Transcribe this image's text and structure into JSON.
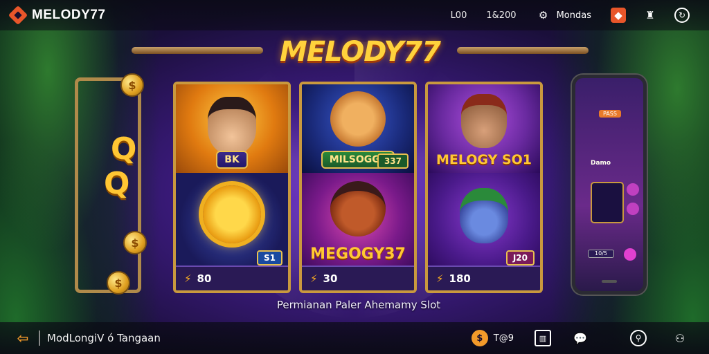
{
  "header": {
    "brand": "MELODY77",
    "stat_1": "L00",
    "stat_2": "1&200",
    "menu_label": "Mondas"
  },
  "hero": {
    "title": "MELODY77"
  },
  "side_decor": {
    "letter_1": "Q",
    "letter_2": "Q"
  },
  "games": [
    {
      "top_label": "BK",
      "bottom_badge": "S1",
      "footer_value": "80",
      "top_color": "#f0a020",
      "bottom_color": "#2a3a9a"
    },
    {
      "top_label": "MILSOGGE",
      "top_badge": "337",
      "bottom_label": "MEGOGY37",
      "footer_value": "30",
      "top_color": "#1a3aa0",
      "bottom_color": "#a02a8a"
    },
    {
      "top_label": "MELOGY SO1",
      "bottom_badge": "J20",
      "footer_value": "180",
      "top_color": "#7a2a9a",
      "bottom_color": "#5a2aa0"
    }
  ],
  "subtitle": "Permianan Paler Ahemamy Slot",
  "phone": {
    "chip": "PASS",
    "text": "Damo",
    "bar": "10/5"
  },
  "footer": {
    "breadcrumb": "ModLongiV ó Tangaan",
    "stat_label": "T@9"
  },
  "colors": {
    "accent": "#e8562a",
    "gold": "#c9993e",
    "title": "#ffd23c"
  }
}
